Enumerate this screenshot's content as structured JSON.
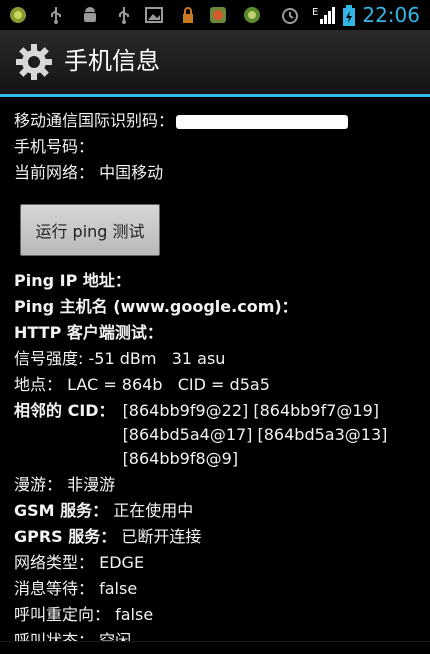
{
  "status_bar": {
    "icons": [
      "gingerbread-icon",
      "usb-icon",
      "android-debug-icon",
      "usb-icon",
      "image-icon",
      "lock-icon",
      "app-icon",
      "gallery-icon",
      "alarm-icon",
      "signal-icon",
      "battery-icon"
    ],
    "time": "22:06",
    "network_letter": "E"
  },
  "title_bar": {
    "title": "手机信息",
    "icon": "gear-icon"
  },
  "info": {
    "imei_label": "移动通信国际识别码：",
    "phone_label": "手机号码：",
    "network_label": "当前网络：",
    "network_value": "中国移动"
  },
  "ping_button": {
    "label": "运行 ping 测试"
  },
  "details": {
    "ping_ip_label": "Ping IP 地址：",
    "ping_host_label": "Ping 主机名 (www.google.com)：",
    "http_label": "HTTP 客户端测试：",
    "signal_label": "信号强度:",
    "signal_value": "-51 dBm   31 asu",
    "location_label": "地点：",
    "location_value": "LAC = 864b   CID = d5a5",
    "neighbor_cid_label": "相邻的 CID：",
    "neighbor_cid_value": "[864bb9f9@22] [864bb9f7@19] [864bd5a4@17] [864bd5a3@13] [864bb9f8@9]",
    "roaming_label": "漫游：",
    "roaming_value": "非漫游",
    "gsm_label": "GSM 服务：",
    "gsm_value": "正在使用中",
    "gprs_label": "GPRS 服务：",
    "gprs_value": "已断开连接",
    "network_type_label": "网络类型：",
    "network_type_value": "EDGE",
    "msg_waiting_label": "消息等待：",
    "msg_waiting_value": "false",
    "call_redirect_label": "呼叫重定向：",
    "call_redirect_value": "false",
    "call_state_label": "呼叫状态：",
    "call_state_value": "空闲"
  }
}
